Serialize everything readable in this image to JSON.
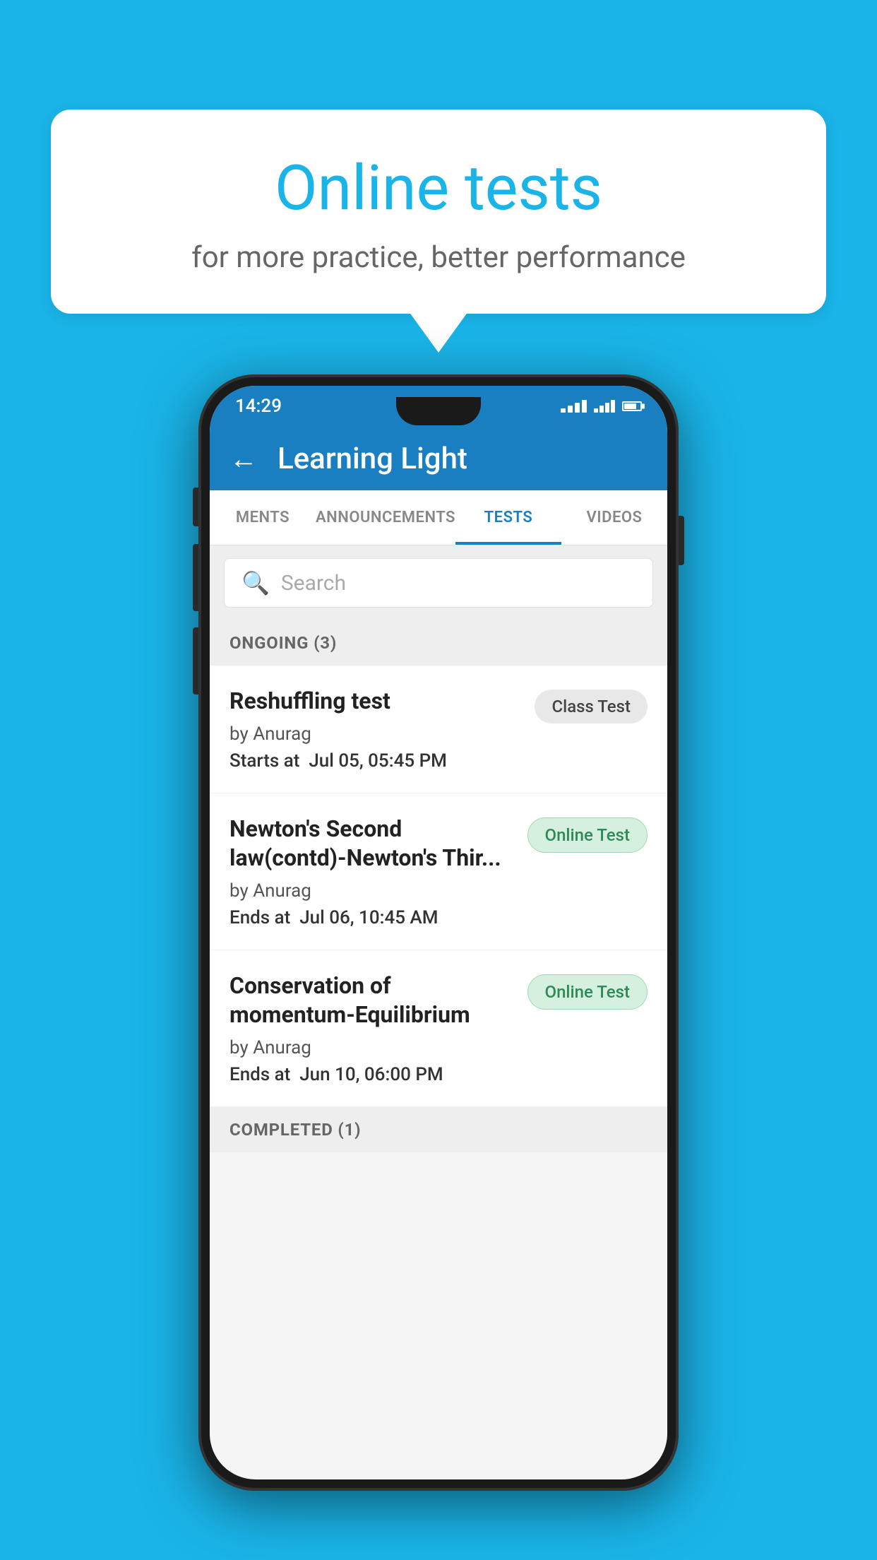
{
  "page": {
    "background_color": "#1ab4e8"
  },
  "speech_bubble": {
    "title": "Online tests",
    "subtitle": "for more practice, better performance"
  },
  "phone": {
    "status_bar": {
      "time": "14:29"
    },
    "app_bar": {
      "title": "Learning Light",
      "back_label": "←"
    },
    "tabs": [
      {
        "label": "MENTS",
        "active": false
      },
      {
        "label": "ANNOUNCEMENTS",
        "active": false
      },
      {
        "label": "TESTS",
        "active": true
      },
      {
        "label": "VIDEOS",
        "active": false
      }
    ],
    "search": {
      "placeholder": "Search"
    },
    "ongoing_section": {
      "header": "ONGOING (3)",
      "tests": [
        {
          "name": "Reshuffling test",
          "author": "by Anurag",
          "time_label": "Starts at",
          "time_value": "Jul 05, 05:45 PM",
          "badge": "Class Test",
          "badge_type": "class"
        },
        {
          "name": "Newton's Second law(contd)-Newton's Thir...",
          "author": "by Anurag",
          "time_label": "Ends at",
          "time_value": "Jul 06, 10:45 AM",
          "badge": "Online Test",
          "badge_type": "online"
        },
        {
          "name": "Conservation of momentum-Equilibrium",
          "author": "by Anurag",
          "time_label": "Ends at",
          "time_value": "Jun 10, 06:00 PM",
          "badge": "Online Test",
          "badge_type": "online"
        }
      ]
    },
    "completed_section": {
      "header": "COMPLETED (1)"
    }
  }
}
